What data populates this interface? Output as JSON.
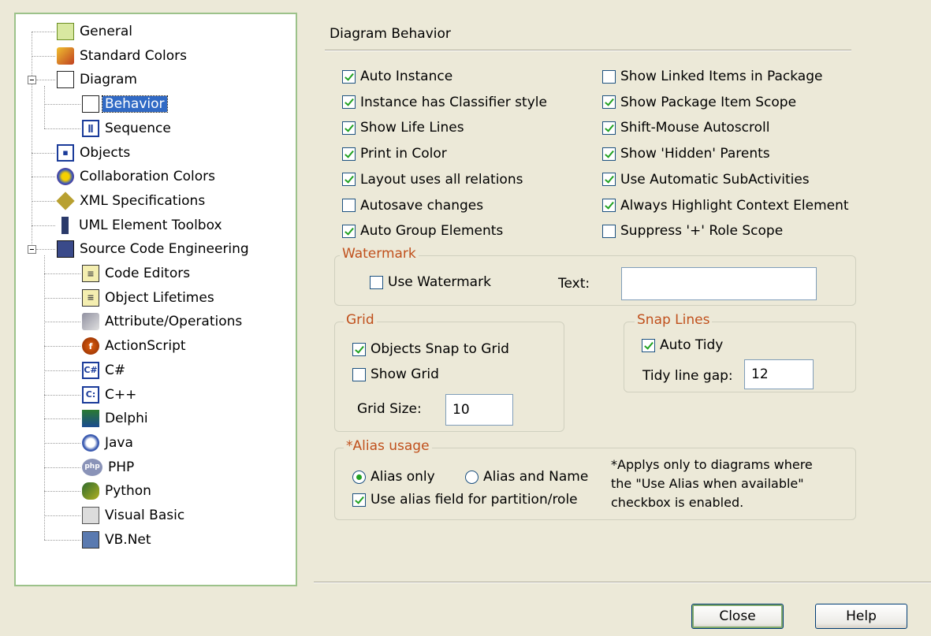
{
  "tree": {
    "items": [
      {
        "label": "General",
        "icon": "general-icon"
      },
      {
        "label": "Standard Colors",
        "icon": "paint-icon"
      },
      {
        "label": "Diagram",
        "icon": "document-icon"
      },
      {
        "label": "Behavior",
        "icon": "document-icon",
        "selected": true
      },
      {
        "label": "Sequence",
        "icon": "sequence-icon"
      },
      {
        "label": "Objects",
        "icon": "objects-icon"
      },
      {
        "label": "Collaboration Colors",
        "icon": "palette-icon"
      },
      {
        "label": "XML Specifications",
        "icon": "xml-icon"
      },
      {
        "label": "UML Element Toolbox",
        "icon": "toolbox-icon"
      },
      {
        "label": "Source Code Engineering",
        "icon": "source-code-icon"
      },
      {
        "label": "Code Editors",
        "icon": "code-file-icon"
      },
      {
        "label": "Object Lifetimes",
        "icon": "code-file-icon"
      },
      {
        "label": "Attribute/Operations",
        "icon": "attribute-icon"
      },
      {
        "label": "ActionScript",
        "icon": "actionscript-icon"
      },
      {
        "label": "C#",
        "icon": "csharp-icon",
        "badge": "C#"
      },
      {
        "label": "C++",
        "icon": "cpp-icon",
        "badge": "C:"
      },
      {
        "label": "Delphi",
        "icon": "delphi-icon"
      },
      {
        "label": "Java",
        "icon": "java-icon"
      },
      {
        "label": "PHP",
        "icon": "php-icon",
        "badge": "php"
      },
      {
        "label": "Python",
        "icon": "python-icon"
      },
      {
        "label": "Visual Basic",
        "icon": "vb-icon"
      },
      {
        "label": "VB.Net",
        "icon": "vbnet-icon"
      }
    ]
  },
  "section_title": "Diagram Behavior",
  "checkboxes": {
    "left": [
      {
        "label": "Auto Instance",
        "checked": true
      },
      {
        "label": "Instance has Classifier style",
        "checked": true
      },
      {
        "label": "Show Life Lines",
        "checked": true
      },
      {
        "label": "Print in Color",
        "checked": true
      },
      {
        "label": "Layout uses all relations",
        "checked": true
      },
      {
        "label": "Autosave changes",
        "checked": false
      },
      {
        "label": "Auto Group Elements",
        "checked": true
      }
    ],
    "right": [
      {
        "label": "Show Linked Items in Package",
        "checked": false
      },
      {
        "label": "Show Package Item Scope",
        "checked": true
      },
      {
        "label": "Shift-Mouse Autoscroll",
        "checked": true
      },
      {
        "label": "Show 'Hidden' Parents",
        "checked": true
      },
      {
        "label": "Use Automatic SubActivities",
        "checked": true
      },
      {
        "label": "Always Highlight Context Element",
        "checked": true
      },
      {
        "label": "Suppress '+' Role Scope",
        "checked": false
      }
    ]
  },
  "watermark": {
    "title": "Watermark",
    "use_label": "Use Watermark",
    "use_checked": false,
    "text_label": "Text:",
    "text_value": ""
  },
  "grid": {
    "title": "Grid",
    "snap_label": "Objects Snap to Grid",
    "snap_checked": true,
    "show_label": "Show Grid",
    "show_checked": false,
    "size_label": "Grid Size:",
    "size_value": "10"
  },
  "snap_lines": {
    "title": "Snap Lines",
    "tidy_label": "Auto Tidy",
    "tidy_checked": true,
    "gap_label": "Tidy line gap:",
    "gap_value": "12"
  },
  "alias": {
    "title": "*Alias usage",
    "alias_only_label": "Alias only",
    "alias_and_name_label": "Alias and Name",
    "selected": "alias_only",
    "partition_label": "Use alias field for partition/role",
    "partition_checked": true,
    "note_line1": "*Applys only to diagrams where",
    "note_line2": "the \"Use Alias when available\"",
    "note_line3": "checkbox is enabled."
  },
  "buttons": {
    "close": "Close",
    "help": "Help"
  }
}
